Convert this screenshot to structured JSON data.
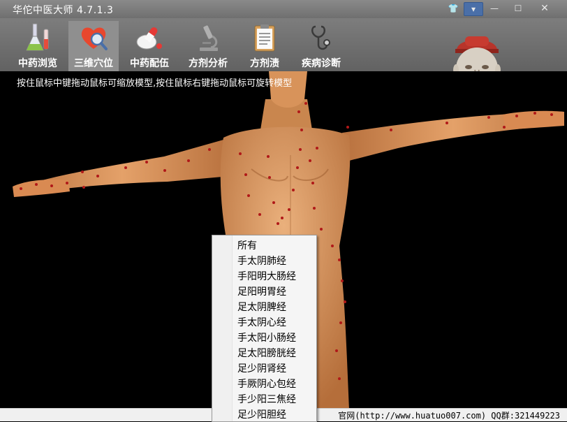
{
  "window": {
    "title": "华佗中医大师 4.7.1.3",
    "buttons": {
      "skin": "👕",
      "menu": "▾",
      "minimize": "—",
      "maximize": "☐",
      "close": "✕"
    }
  },
  "toolbar": {
    "tabs": [
      {
        "label": "中药浏览",
        "icon": "flask-icon"
      },
      {
        "label": "三维穴位",
        "icon": "heart-magnifier-icon",
        "active": true
      },
      {
        "label": "中药配伍",
        "icon": "pills-icon"
      },
      {
        "label": "方剂分析",
        "icon": "microscope-icon"
      },
      {
        "label": "方剂渍",
        "icon": "clipboard-icon"
      },
      {
        "label": "疾病诊断",
        "icon": "stethoscope-icon"
      }
    ]
  },
  "viewport": {
    "hint": "按住鼠标中键拖动鼠标可缩放模型,按住鼠标右键拖动鼠标可旋转模型"
  },
  "statusbar": {
    "text": "官网(http://www.huatuo007.com) QQ群:321449223"
  },
  "context_menu": {
    "items": [
      "所有",
      "手太阴肺经",
      "手阳明大肠经",
      "足阳明胃经",
      "足太阴脾经",
      "手太阴心经",
      "手太阳小肠经",
      "足太阳膀胱经",
      "足少阴肾经",
      "手厥阴心包经",
      "手少阳三焦经",
      "足少阳胆经"
    ]
  },
  "colors": {
    "titlebar": "#7a7a7a",
    "toolbar": "#6e6e6e",
    "active_tab": "#8f8f8f",
    "skin": "#d9925a",
    "acupoint": "#b01818",
    "viewport_bg": "#000000"
  }
}
